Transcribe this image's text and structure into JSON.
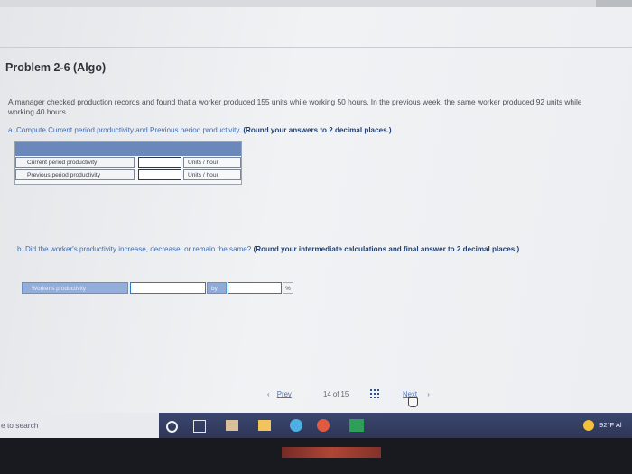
{
  "header": {
    "title": "Problem 2-6 (Algo)"
  },
  "problem": {
    "text": "A manager checked production records and found that a worker produced 155 units while working 50 hours. In the previous week, the same worker produced 92 units while working 40 hours."
  },
  "part_a": {
    "prompt": "a. Compute Current period productivity and Previous period productivity.",
    "instruction": "(Round your answers to 2 decimal places.)",
    "rows": [
      {
        "label": "Current period productivity",
        "value": "",
        "unit": "Units / hour"
      },
      {
        "label": "Previous period productivity",
        "value": "",
        "unit": "Units / hour"
      }
    ]
  },
  "part_b": {
    "prompt": "b. Did the worker's productivity increase, decrease, or remain the same?",
    "instruction": "(Round your intermediate calculations and final answer to 2 decimal places.)",
    "label": "Worker's productivity",
    "select_value": "",
    "by_label": "by",
    "input_value": "",
    "percent_label": "%"
  },
  "pagination": {
    "prev_label": "Prev",
    "page_current": "14",
    "of_label": "of",
    "page_total": "15",
    "next_label": "Next"
  },
  "taskbar": {
    "search_placeholder": "e to search",
    "weather_temp": "92°F",
    "weather_suffix": "Al",
    "icons": [
      "cortana-icon",
      "task-view-icon",
      "store-icon",
      "file-explorer-icon",
      "edge-icon",
      "chrome-icon",
      "excel-icon"
    ]
  },
  "colors": {
    "accent_blue": "#6a88b9",
    "link_blue": "#4a74b6",
    "taskbar": "#2e3656"
  }
}
